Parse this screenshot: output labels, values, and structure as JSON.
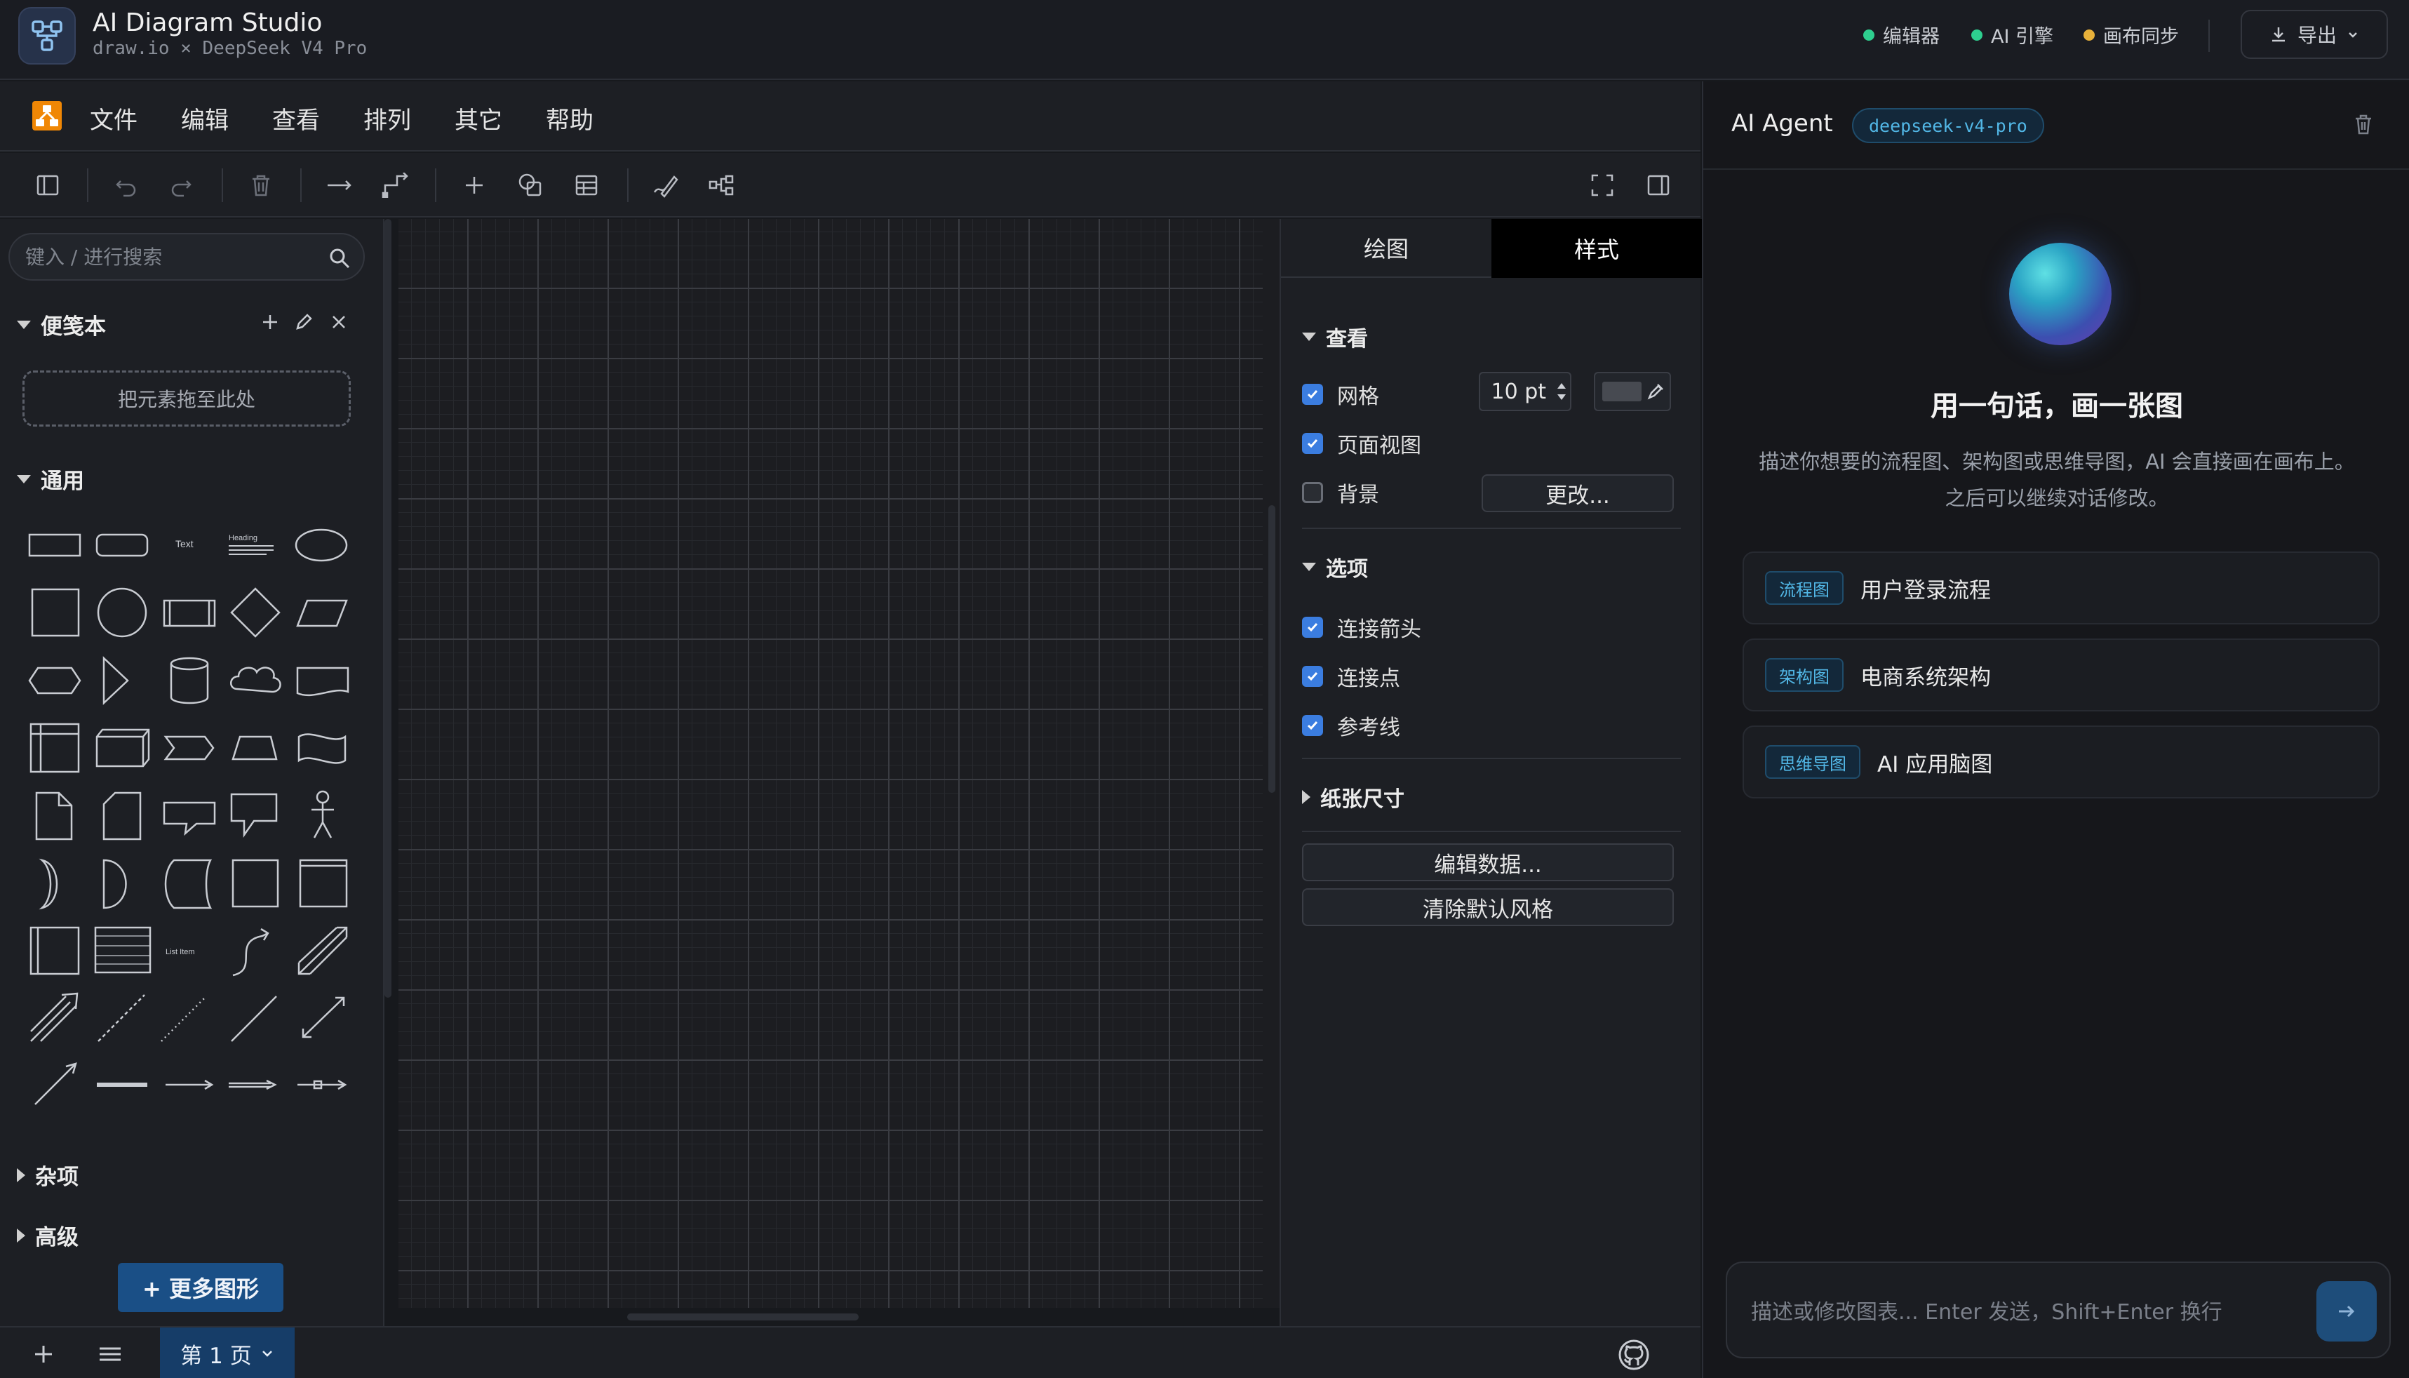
{
  "header": {
    "title": "AI Diagram Studio",
    "subtitle": "draw.io × DeepSeek V4 Pro",
    "status": [
      {
        "label": "编辑器",
        "color": "#2ecf8f"
      },
      {
        "label": "AI 引擎",
        "color": "#2ecf8f"
      },
      {
        "label": "画布同步",
        "color": "#e8b13a"
      }
    ],
    "export_label": "导出"
  },
  "menu": {
    "items": [
      "文件",
      "编辑",
      "查看",
      "排列",
      "其它",
      "帮助"
    ]
  },
  "sidebar": {
    "search_placeholder": "键入 / 进行搜索",
    "scratchpad": {
      "title": "便笺本",
      "drop_hint": "把元素拖至此处"
    },
    "general": {
      "title": "通用"
    },
    "shape_text": {
      "text": "Text",
      "heading": "Heading",
      "list_item": "List Item"
    },
    "misc": {
      "title": "杂项"
    },
    "advanced": {
      "title": "高级"
    },
    "more_shapes_label": "+ 更多图形"
  },
  "format_panel": {
    "tabs": [
      "绘图",
      "样式"
    ],
    "view": {
      "title": "查看",
      "grid_label": "网格",
      "grid_size": "10 pt",
      "page_view_label": "页面视图",
      "background_label": "背景",
      "change_button": "更改..."
    },
    "options": {
      "title": "选项",
      "connection_arrows": "连接箭头",
      "connection_points": "连接点",
      "guides": "参考线"
    },
    "paper_size": {
      "title": "纸张尺寸"
    },
    "edit_data_button": "编辑数据...",
    "clear_style_button": "清除默认风格"
  },
  "bottom_bar": {
    "page_tab": "第 1 页"
  },
  "agent": {
    "title": "AI Agent",
    "model": "deepseek-v4-pro",
    "hero_title": "用一句话，画一张图",
    "hero_desc": "描述你想要的流程图、架构图或思维导图，AI 会直接画在画布上。之后可以继续对话修改。",
    "suggestions": [
      {
        "tag": "流程图",
        "text": "用户登录流程"
      },
      {
        "tag": "架构图",
        "text": "电商系统架构"
      },
      {
        "tag": "思维导图",
        "text": "AI 应用脑图"
      }
    ],
    "input_placeholder": "描述或修改图表... Enter 发送，Shift+Enter 换行"
  },
  "colors": {
    "accent": "#3b7de0",
    "ok": "#2ecf8f",
    "warn": "#e8b13a",
    "agent_accent": "#52b7e6"
  }
}
